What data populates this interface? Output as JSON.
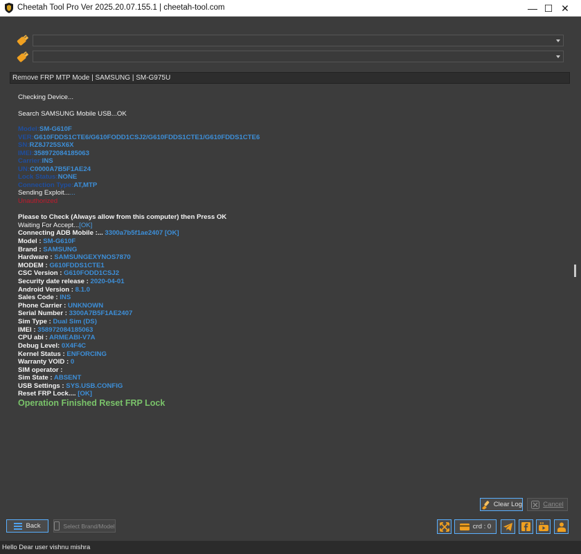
{
  "window": {
    "title": "Cheetah Tool Pro Ver 2025.20.07.155.1 | cheetah-tool.com",
    "minimize": "—",
    "maximize": "☐",
    "close": "✕"
  },
  "mode_bar": "Remove FRP MTP Mode | SAMSUNG | SM-G975U",
  "log": [
    {
      "style": "w",
      "label": "Checking Device...",
      "value": ""
    },
    {
      "style": "w",
      "label": "Search SAMSUNG Mobile USB...OK",
      "value": ""
    },
    {
      "style": "kv-navy",
      "label": "Model:",
      "value": "SM-G610F"
    },
    {
      "style": "kv-navy",
      "label": "VER:",
      "value": "G610FDDS1CTE6/G610FODD1CSJ2/G610FDDS1CTE1/G610FDDS1CTE6"
    },
    {
      "style": "kv-navy",
      "label": "SN:",
      "value": "RZ8J725SX6X"
    },
    {
      "style": "kv-navy",
      "label": "IMEI:",
      "value": "358972084185063"
    },
    {
      "style": "kv-navy",
      "label": "Carrier:",
      "value": "INS"
    },
    {
      "style": "kv-navy",
      "label": "UN:",
      "value": "C0000A7B5F1AE24"
    },
    {
      "style": "kv-navy",
      "label": "Lock Status:",
      "value": "NONE"
    },
    {
      "style": "kv-navy",
      "label": "Connection Type:",
      "value": "AT,MTP"
    },
    {
      "style": "kv-w-sky",
      "label": "Sending Exploit...",
      "value": "..."
    },
    {
      "style": "red",
      "label": "Unauthorized",
      "value": ""
    },
    {
      "style": "b",
      "label": "Please to Check (Always allow from this computer) then Press OK",
      "value": ""
    },
    {
      "style": "kv-w-sky",
      "label": "Waiting For Accept...",
      "value": "[OK]"
    },
    {
      "style": "kv-b-blue",
      "label": "Connecting ADB Mobile :... ",
      "value": "3300a7b5f1ae2407 [OK]"
    },
    {
      "style": "kv-b-blue",
      "label": "Model : ",
      "value": "SM-G610F"
    },
    {
      "style": "kv-b-blue",
      "label": "Brand : ",
      "value": "SAMSUNG"
    },
    {
      "style": "kv-b-blue",
      "label": "Hardware : ",
      "value": "SAMSUNGEXYNOS7870"
    },
    {
      "style": "kv-b-blue",
      "label": "MODEM : ",
      "value": "G610FDDS1CTE1"
    },
    {
      "style": "kv-b-blue",
      "label": "CSC Version : ",
      "value": "G610FODD1CSJ2"
    },
    {
      "style": "kv-b-blue",
      "label": "Security date release : ",
      "value": "2020-04-01"
    },
    {
      "style": "kv-b-blue",
      "label": "Android Version : ",
      "value": "8.1.0"
    },
    {
      "style": "kv-b-blue",
      "label": "Sales Code : ",
      "value": "INS"
    },
    {
      "style": "kv-b-blue",
      "label": "Phone Carrier : ",
      "value": "UNKNOWN"
    },
    {
      "style": "kv-b-blue",
      "label": "Serial Number : ",
      "value": "3300A7B5F1AE2407"
    },
    {
      "style": "kv-b-blue",
      "label": "Sim Type : ",
      "value": "Dual Sim (DS)"
    },
    {
      "style": "kv-b-blue",
      "label": "IMEI : ",
      "value": "358972084185063"
    },
    {
      "style": "kv-b-blue",
      "label": "CPU abi : ",
      "value": "ARMEABI-V7A"
    },
    {
      "style": "kv-b-blue",
      "label": "Debug Level: ",
      "value": "0X4F4C"
    },
    {
      "style": "kv-b-blue",
      "label": "Kernel Status : ",
      "value": "ENFORCING"
    },
    {
      "style": "kv-b-blue",
      "label": "Warranty VOID : ",
      "value": "0"
    },
    {
      "style": "kv-b-blue",
      "label": "SIM operator : ",
      "value": ""
    },
    {
      "style": "kv-b-blue",
      "label": "Sim State : ",
      "value": "ABSENT"
    },
    {
      "style": "kv-b-blue",
      "label": "USB Settings : ",
      "value": "SYS.USB.CONFIG"
    },
    {
      "style": "kv-b-blue",
      "label": "Reset FRP Lock.... ",
      "value": "[OK]"
    },
    {
      "style": "green",
      "label": "Operation Finished Reset FRP Lock",
      "value": ""
    }
  ],
  "buttons": {
    "clear_log": "Clear Log",
    "cancel": "Cancel",
    "back": "Back",
    "select_brand": "Select Brand/Model",
    "credits": "crd : 0"
  },
  "status": "Hello Dear user vishnu mishra",
  "icons": {
    "usb": "usb-icon",
    "clear": "brush-icon",
    "cancel": "cancel-icon",
    "back": "menu-icon",
    "select": "phone-icon",
    "fullscreen": "expand-icon",
    "credit": "credit-card-icon",
    "telegram": "telegram-icon",
    "facebook": "facebook-icon",
    "youtube": "youtube-icon",
    "user": "user-icon"
  },
  "colors": {
    "accent": "#5ab0ff",
    "orange": "#f0a020",
    "value_blue": "#3d8fd9",
    "label_navy": "#1f4e9e",
    "error_red": "#c21b2d",
    "success_green": "#7ac36a"
  }
}
